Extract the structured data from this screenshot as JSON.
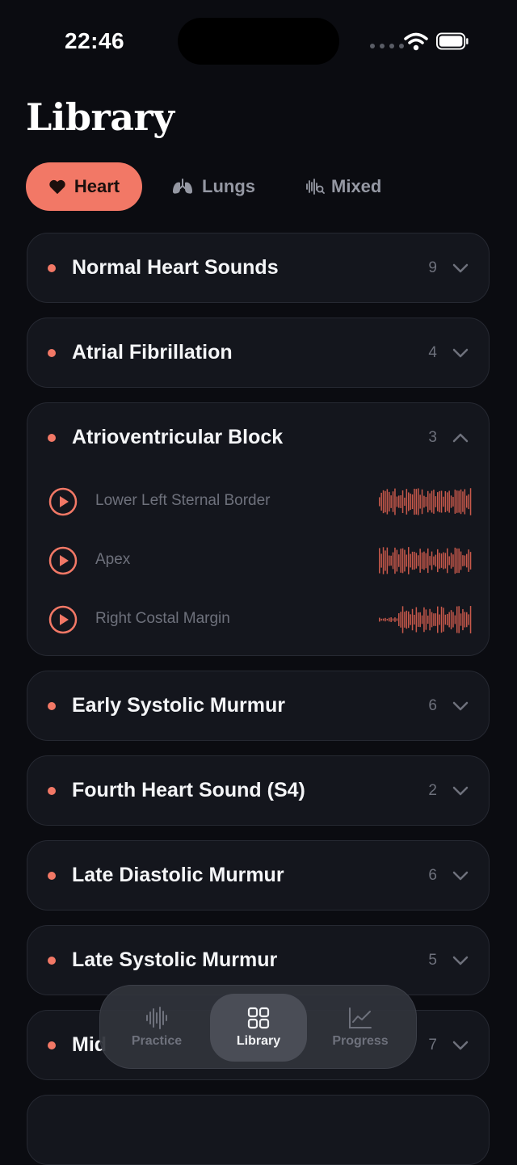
{
  "status_bar": {
    "time": "22:46"
  },
  "page": {
    "title": "Library"
  },
  "segments": [
    {
      "label": "Heart",
      "icon": "heart-icon",
      "active": true
    },
    {
      "label": "Lungs",
      "icon": "lungs-icon",
      "active": false
    },
    {
      "label": "Mixed",
      "icon": "waveform-search-icon",
      "active": false
    }
  ],
  "categories": [
    {
      "title": "Normal Heart Sounds",
      "count": "9",
      "expanded": false
    },
    {
      "title": "Atrial Fibrillation",
      "count": "4",
      "expanded": false
    },
    {
      "title": "Atrioventricular Block",
      "count": "3",
      "expanded": true,
      "recordings": [
        {
          "label": "Lower Left Sternal Border"
        },
        {
          "label": "Apex"
        },
        {
          "label": "Right Costal Margin"
        }
      ]
    },
    {
      "title": "Early Systolic Murmur",
      "count": "6",
      "expanded": false
    },
    {
      "title": "Fourth Heart Sound (S4)",
      "count": "2",
      "expanded": false
    },
    {
      "title": "Late Diastolic Murmur",
      "count": "6",
      "expanded": false
    },
    {
      "title": "Late Systolic Murmur",
      "count": "5",
      "expanded": false
    },
    {
      "title": "Mid",
      "count": "7",
      "expanded": false
    }
  ],
  "tab_bar": [
    {
      "label": "Practice",
      "icon": "waveform-icon",
      "active": false
    },
    {
      "label": "Library",
      "icon": "grid-icon",
      "active": true
    },
    {
      "label": "Progress",
      "icon": "chart-icon",
      "active": false
    }
  ],
  "colors": {
    "accent": "#f27866",
    "background": "#0b0c11",
    "card": "#14161d",
    "muted": "#6e717c"
  }
}
